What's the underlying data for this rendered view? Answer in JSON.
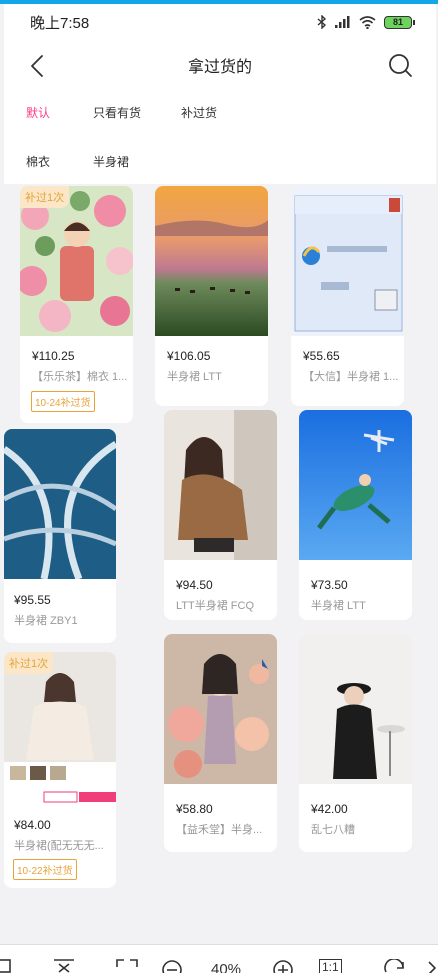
{
  "status": {
    "time": "晚上7:58",
    "battery": "81"
  },
  "nav": {
    "title": "拿过货的"
  },
  "filters": [
    "默认",
    "只看有货",
    "补过货",
    "棉衣",
    "半身裙"
  ],
  "products": [
    {
      "price": "¥110.25",
      "name": "【乐乐茶】棉衣 1...",
      "tag": "10-24补过货",
      "corner": "补过1次"
    },
    {
      "price": "¥106.05",
      "name": "半身裙 LTT"
    },
    {
      "price": "¥55.65",
      "name": "【大信】半身裙 1..."
    },
    {
      "price": "¥95.55",
      "name": "半身裙 ZBY1"
    },
    {
      "price": "¥94.50",
      "name": "LTT半身裙 FCQ"
    },
    {
      "price": "¥73.50",
      "name": "半身裙 LTT"
    },
    {
      "price": "¥84.00",
      "name": "半身裙(配无无无...",
      "tag": "10-22补过货",
      "corner": "补过1次"
    },
    {
      "price": "¥58.80",
      "name": "【益禾堂】半身..."
    },
    {
      "price": "¥42.00",
      "name": "乱七八糟"
    }
  ],
  "toolbar": {
    "zoom": "40%",
    "ratio": "1:1"
  },
  "colors": {
    "accent": "#ff3c8a",
    "restock": "#e8a33a",
    "top_bar": "#12a7e8"
  }
}
